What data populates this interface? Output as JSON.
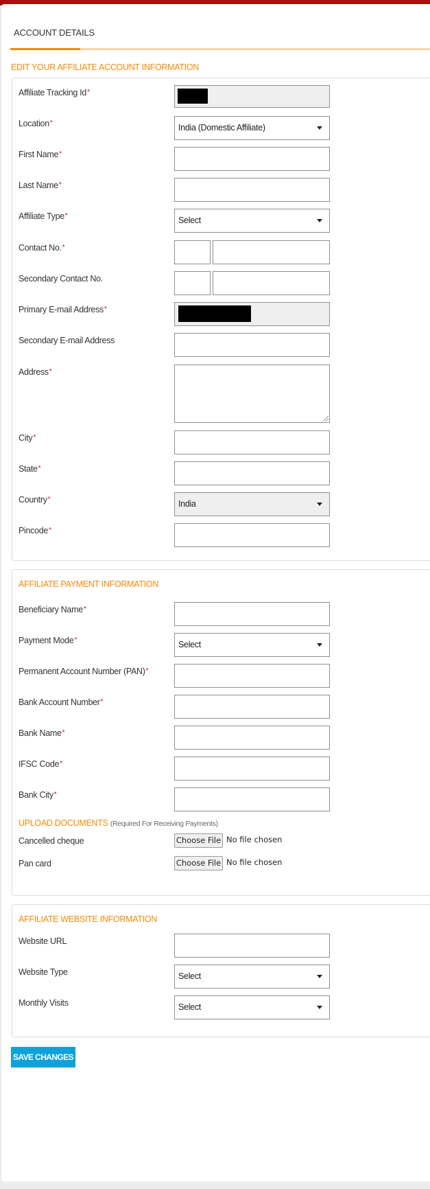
{
  "colors": {
    "top_bar": "#ac0d0d",
    "accent": "#f38a0a",
    "required_marker": "#e0001a",
    "save_button": "#0fa2da"
  },
  "tab": {
    "label": "ACCOUNT DETAILS"
  },
  "edit_heading": "EDIT YOUR AFFILIATE ACCOUNT INFORMATION",
  "required_marker": "*",
  "account": {
    "tracking_id": {
      "label": "Affiliate Tracking Id",
      "value": "[redacted]"
    },
    "location": {
      "label": "Location",
      "value": "India (Domestic Affiliate)"
    },
    "first_name": {
      "label": "First Name",
      "value": ""
    },
    "last_name": {
      "label": "Last Name",
      "value": ""
    },
    "affiliate_type": {
      "label": "Affiliate Type",
      "value": "Select"
    },
    "contact_no": {
      "label": "Contact No.",
      "code": "",
      "number": ""
    },
    "secondary_contact_no": {
      "label": "Secondary Contact No.",
      "code": "",
      "number": ""
    },
    "primary_email": {
      "label": "Primary E-mail Address",
      "value": "[redacted]"
    },
    "secondary_email": {
      "label": "Secondary E-mail Address",
      "value": ""
    },
    "address": {
      "label": "Address",
      "value": ""
    },
    "city": {
      "label": "City",
      "value": ""
    },
    "state": {
      "label": "State",
      "value": ""
    },
    "country": {
      "label": "Country",
      "value": "India"
    },
    "pincode": {
      "label": "Pincode",
      "value": ""
    }
  },
  "payment": {
    "title": "AFFILIATE PAYMENT INFORMATION",
    "beneficiary_name": {
      "label": "Beneficiary Name",
      "value": ""
    },
    "payment_mode": {
      "label": "Payment Mode",
      "value": "Select"
    },
    "pan": {
      "label": "Permanent Account Number (PAN)",
      "value": ""
    },
    "bank_account": {
      "label": "Bank Account Number",
      "value": ""
    },
    "bank_name": {
      "label": "Bank Name",
      "value": ""
    },
    "ifsc": {
      "label": "IFSC Code",
      "value": ""
    },
    "bank_city": {
      "label": "Bank City",
      "value": ""
    },
    "upload": {
      "title": "UPLOAD DOCUMENTS",
      "note": "(Required For Receiving Payments)",
      "cheque": {
        "label": "Cancelled cheque",
        "button": "Choose File",
        "status": "No file chosen"
      },
      "pan_card": {
        "label": "Pan card",
        "button": "Choose File",
        "status": "No file chosen"
      }
    }
  },
  "website": {
    "title": "AFFILIATE WEBSITE INFORMATION",
    "url": {
      "label": "Website URL",
      "value": ""
    },
    "type": {
      "label": "Website Type",
      "value": "Select"
    },
    "monthly_visits": {
      "label": "Monthly Visits",
      "value": "Select"
    }
  },
  "save_button": "SAVE CHANGES"
}
